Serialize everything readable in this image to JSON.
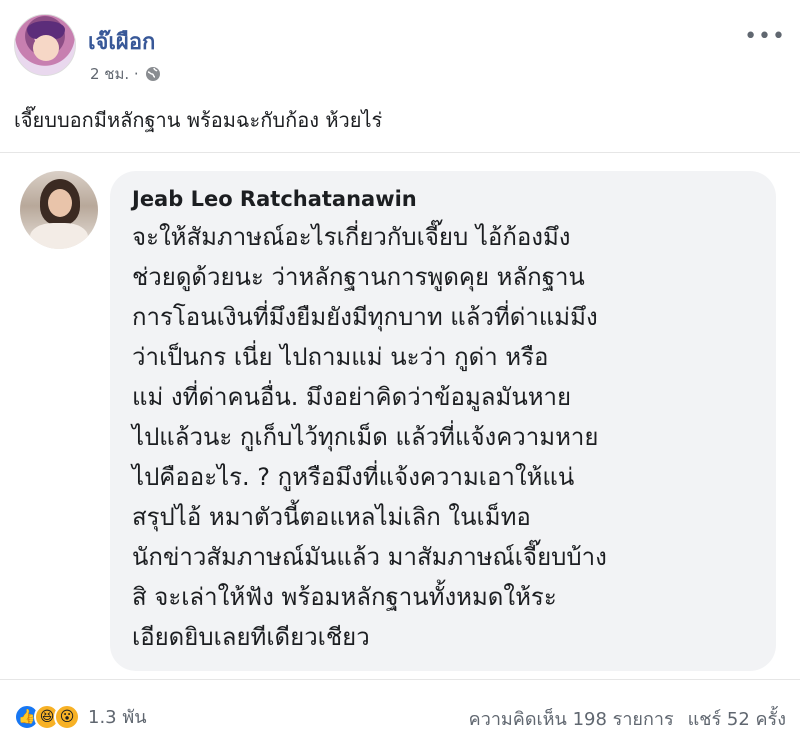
{
  "post": {
    "author": "เจ๊เผือก",
    "time": "2 ชม. ·",
    "more_icon": "•••",
    "caption": "เจี๊ยบบอกมีหลักฐาน พร้อมฉะกับก้อง ห้วยไร่"
  },
  "comment": {
    "name": "Jeab Leo Ratchatanawin",
    "lines": [
      "จะให้สัมภาษณ์อะไรเกี่ยวกับเจี๊ยบ ไอ้ก้องมึง",
      "ช่วยดูด้วยนะ ว่าหลักฐานการพูดคุย หลักฐาน",
      "การโอนเงินที่มึงยืมยังมีทุกบาท แล้วที่ด่าแม่มึง",
      "ว่าเป็นกร        เนี่ย ไปถามแม่     นะว่า กูด่า หรือ",
      "แม่   งที่ด่าคนอื่น.  มึงอย่าคิดว่าข้อมูลมันหาย",
      "ไปแล้วนะ กูเก็บไว้ทุกเม็ด แล้วที่แจ้งความหาย",
      "ไปคืออะไร. ? กูหรือมึงที่แจ้งความเอาให้แน่",
      "สรุปไอ้              หมาตัวนี้ตอแหลไม่เลิก ในเม็ทอ",
      "นักข่าวสัมภาษณ์มันแล้ว มาสัมภาษณ์เจี๊ยบบ้าง",
      "สิ จะเล่าให้ฟัง พร้อมหลักฐานทั้งหมดให้ระ",
      "เอียดยิบเลยทีเดียวเชียว"
    ]
  },
  "footer": {
    "reaction_count": "1.3 พัน",
    "comments": "ความคิดเห็น 198 รายการ",
    "shares": "แชร์ 52 ครั้ง",
    "reactions": [
      "like-icon",
      "haha-icon",
      "wow-icon"
    ]
  }
}
